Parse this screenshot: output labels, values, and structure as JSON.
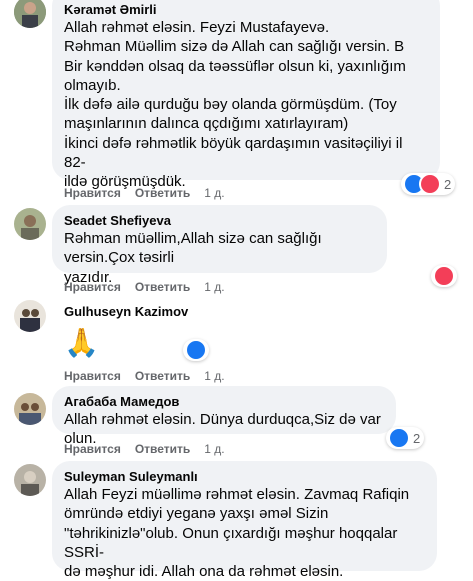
{
  "actions": {
    "like": "Нравится",
    "reply": "Ответить"
  },
  "comments": [
    {
      "author": "Kəramət Əmirli",
      "text": "Allah rəhmət eləsin. Feyzi Mustafayevə.\nRəhman Müəllim sizə də Allah can sağlığı versin. B\nBir kənddən olsaq da təəssüflər olsun ki, yaxınlığım\nolmayıb.\nİlk dəfə ailə qurduğu bəy olanda görmüşdüm. (Toy\nmaşınlarının dalınca qçdığımı xatırlayıram)\nİkinci dəfə rəhmətlik böyük qardaşımın vasitəçiliyi il 82-\nildə görüşmüşdük.",
      "time": "1 д.",
      "reaction_count": "2",
      "reactions": [
        "like",
        "love"
      ]
    },
    {
      "author": "Seadet Shefiyeva",
      "text": "Rəhman müəllim,Allah sizə can sağlığı versin.Çox təsirli\nyazıdır.",
      "time": "1 д.",
      "reaction_count": "",
      "reactions": [
        "love"
      ]
    },
    {
      "author": "Gulhuseyn Kazimov",
      "text": "🙏",
      "time": "1 д.",
      "reaction_count": "",
      "reactions": [
        "like"
      ]
    },
    {
      "author": "Агабаба Мамедов",
      "text": "Allah rəhmət eləsin. Dünya durduqca,Siz də var olun.",
      "time": "1 д.",
      "reaction_count": "2",
      "reactions": [
        "like"
      ]
    },
    {
      "author": "Suleyman Suleymanlı",
      "text": "Allah Feyzi müəllimə rəhmət eləsin. Zavmaq Rafiqin\nömründə etdiyi yeganə yaxşı əməl Sizin\n\"təhrikinizlə\"olub. Onun çıxardığı məşhur hoqqalar SSRİ-\ndə məşhur idi. Allah ona da rəhmət eləsin.",
      "time": "",
      "reaction_count": "",
      "reactions": []
    }
  ]
}
